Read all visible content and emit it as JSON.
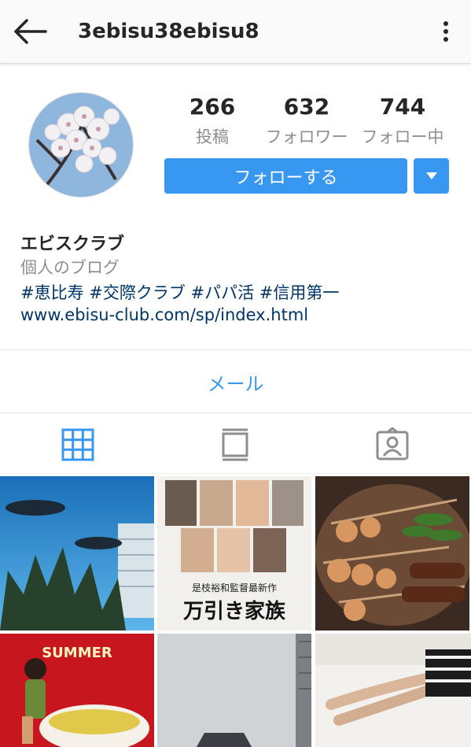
{
  "header": {
    "username": "3ebisu38ebisu8"
  },
  "stats": [
    {
      "value": "266",
      "label": "投稿"
    },
    {
      "value": "632",
      "label": "フォロワー"
    },
    {
      "value": "744",
      "label": "フォロー中"
    }
  ],
  "actions": {
    "follow_label": "フォローする"
  },
  "bio": {
    "name": "エビスクラブ",
    "category": "個人のブログ",
    "hashtags": "#恵比寿 #交際クラブ #パパ活 #信用第一",
    "website": "www.ebisu-club.com/sp/index.html"
  },
  "contact": {
    "mail_label": "メール"
  },
  "posts": {
    "p2_caption_small": "是枝裕和監督最新作",
    "p2_caption_large": "万引き家族",
    "p4_caption": "SUMMER"
  },
  "colors": {
    "accent": "#3897f0",
    "link": "#003569",
    "muted": "#8e8e8e"
  },
  "icons": {
    "back": "arrow-left-icon",
    "more": "vertical-dots-icon",
    "grid": "grid-icon",
    "feed": "feed-icon",
    "tagged": "person-tag-icon",
    "dropdown": "caret-down-icon"
  }
}
